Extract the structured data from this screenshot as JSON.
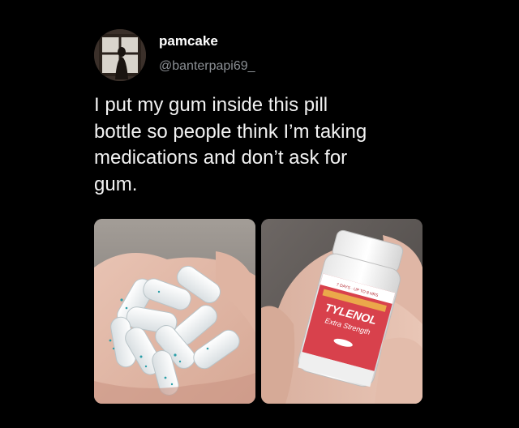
{
  "author": {
    "display_name": "pamcake",
    "handle": "@banterpapi69_",
    "avatar_icon": "profile-photo"
  },
  "tweet": {
    "text": "I put my gum inside this pill\nbottle so people think I’m taking\nmedications and don’t ask for\ngum."
  },
  "media": [
    {
      "name": "gum-in-hand-photo",
      "description_icon": "photo"
    },
    {
      "name": "pill-bottle-photo",
      "bottle_brand": "TYLENOL",
      "bottle_subtitle": "Extra Strength"
    }
  ],
  "colors": {
    "background": "#000000",
    "text_primary": "#ffffff",
    "text_secondary": "#8b8f94",
    "label_red": "#d8414c"
  }
}
